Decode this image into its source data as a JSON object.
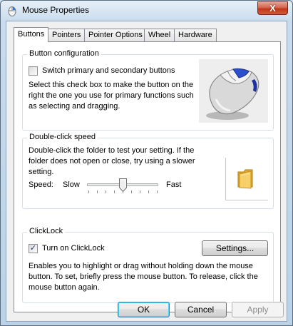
{
  "window": {
    "title": "Mouse Properties",
    "close_glyph": "X"
  },
  "tabs": [
    {
      "label": "Buttons",
      "active": true
    },
    {
      "label": "Pointers",
      "active": false
    },
    {
      "label": "Pointer Options",
      "active": false
    },
    {
      "label": "Wheel",
      "active": false
    },
    {
      "label": "Hardware",
      "active": false
    }
  ],
  "button_config": {
    "legend": "Button configuration",
    "switch_label": "Switch primary and secondary buttons",
    "switch_checked": false,
    "description_1": "Select this check box to make the button on the",
    "description_2": "right the one you use for primary functions such",
    "description_3": "as selecting and dragging."
  },
  "double_click": {
    "legend": "Double-click speed",
    "description_1": "Double-click the folder to test your setting. If the",
    "description_2": "folder does not open or close, try using a slower",
    "description_3": "setting.",
    "speed_label": "Speed:",
    "slow_label": "Slow",
    "fast_label": "Fast",
    "speed_value": 0.5
  },
  "clicklock": {
    "legend": "ClickLock",
    "toggle_label": "Turn on ClickLock",
    "toggle_checked": true,
    "check_glyph": "✓",
    "settings_label": "Settings...",
    "description_1": "Enables you to highlight or drag without holding down the mouse",
    "description_2": "button. To set, briefly press the mouse button. To release, click the",
    "description_3": "mouse button again."
  },
  "footer": {
    "ok_label": "OK",
    "cancel_label": "Cancel",
    "apply_label": "Apply",
    "apply_enabled": false
  },
  "colors": {
    "accent": "#3c7fb1",
    "close": "#c2371c",
    "folder": "#f5c24a"
  }
}
